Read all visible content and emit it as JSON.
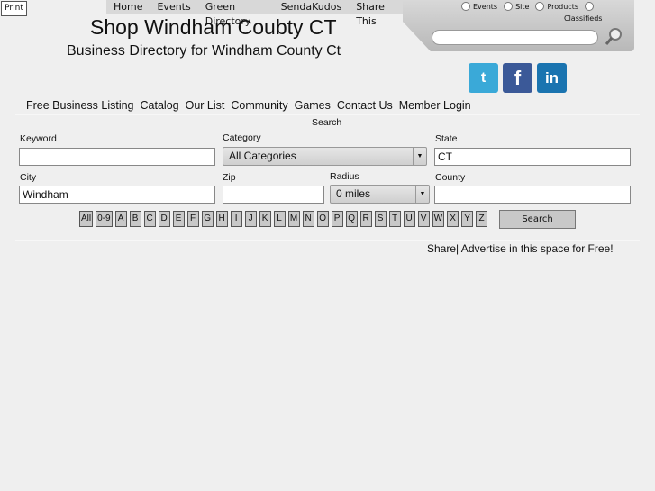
{
  "print_label": "Print",
  "top_nav": [
    "Home",
    "Events",
    "Green Directory",
    "SendaKudos",
    "Share This"
  ],
  "search_scopes": [
    "Events",
    "Site",
    "Products",
    "Classifieds"
  ],
  "site_title": "Shop Windham Coubty CT",
  "site_subtitle": "Business Directory for Windham County Ct",
  "social": [
    "twitter",
    "facebook",
    "linkedin"
  ],
  "social_colors": {
    "twitter": "#3aa9d8",
    "facebook": "#3b5998",
    "linkedin": "#1a74b0"
  },
  "main_nav": [
    "Free Business Listing",
    "Catalog",
    "Our List",
    "Community",
    "Games",
    "Contact Us",
    "Member Login"
  ],
  "search": {
    "heading": "Search",
    "keyword_label": "Keyword",
    "keyword_value": "",
    "category_label": "Category",
    "category_value": "All Categories",
    "state_label": "State",
    "state_value": "CT",
    "city_label": "City",
    "city_value": "Windham",
    "zip_label": "Zip",
    "zip_value": "",
    "radius_label": "Radius",
    "radius_value": "0 miles",
    "county_label": "County",
    "county_value": "",
    "letters": [
      "All",
      "0-9",
      "A",
      "B",
      "C",
      "D",
      "E",
      "F",
      "G",
      "H",
      "I",
      "J",
      "K",
      "L",
      "M",
      "N",
      "O",
      "P",
      "Q",
      "R",
      "S",
      "T",
      "U",
      "V",
      "W",
      "X",
      "Y",
      "Z"
    ],
    "button": "Search"
  },
  "share_text": "Share| Advertise in this space for Free!"
}
